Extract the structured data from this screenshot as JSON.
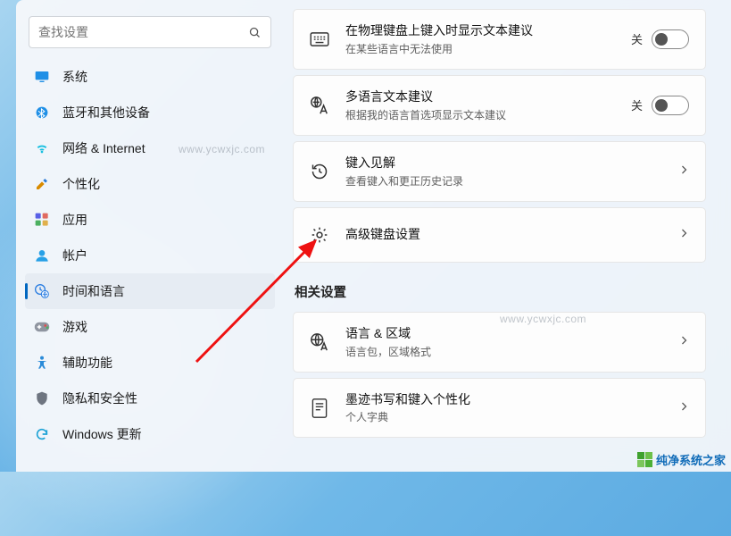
{
  "search": {
    "placeholder": "查找设置"
  },
  "sidebar": {
    "items": [
      {
        "label": "系统",
        "icon": "display-icon",
        "color": "#1f8fe6"
      },
      {
        "label": "蓝牙和其他设备",
        "icon": "bluetooth-icon",
        "color": "#1f8fe6"
      },
      {
        "label": "网络 & Internet",
        "icon": "wifi-icon",
        "color": "#17bfe0"
      },
      {
        "label": "个性化",
        "icon": "paint-icon",
        "color": "#d98b00"
      },
      {
        "label": "应用",
        "icon": "apps-icon",
        "color": "#5860e6"
      },
      {
        "label": "帐户",
        "icon": "account-icon",
        "color": "#27a0e6"
      },
      {
        "label": "时间和语言",
        "icon": "time-lang-icon",
        "color": "#2a7de1",
        "active": true
      },
      {
        "label": "游戏",
        "icon": "gamepad-icon",
        "color": "#49b04c"
      },
      {
        "label": "辅助功能",
        "icon": "access-icon",
        "color": "#2a8bd8"
      },
      {
        "label": "隐私和安全性",
        "icon": "shield-icon",
        "color": "#6e7580"
      },
      {
        "label": "Windows 更新",
        "icon": "update-icon",
        "color": "#1fa3d6"
      }
    ]
  },
  "cards": {
    "typing_suggestions": {
      "title": "在物理键盘上键入时显示文本建议",
      "sub": "在某些语言中无法使用",
      "state_label": "关",
      "state": false
    },
    "multilingual": {
      "title": "多语言文本建议",
      "sub": "根据我的语言首选项显示文本建议",
      "state_label": "关",
      "state": false
    },
    "insights": {
      "title": "键入见解",
      "sub": "查看键入和更正历史记录"
    },
    "advanced_kb": {
      "title": "高级键盘设置"
    }
  },
  "section_related": "相关设置",
  "related": {
    "lang_region": {
      "title": "语言 & 区域",
      "sub": "语言包，区域格式"
    },
    "inking": {
      "title": "墨迹书写和键入个性化",
      "sub": "个人字典"
    }
  },
  "watermark": "www.ycwxjc.com",
  "brand": "纯净系统之家"
}
